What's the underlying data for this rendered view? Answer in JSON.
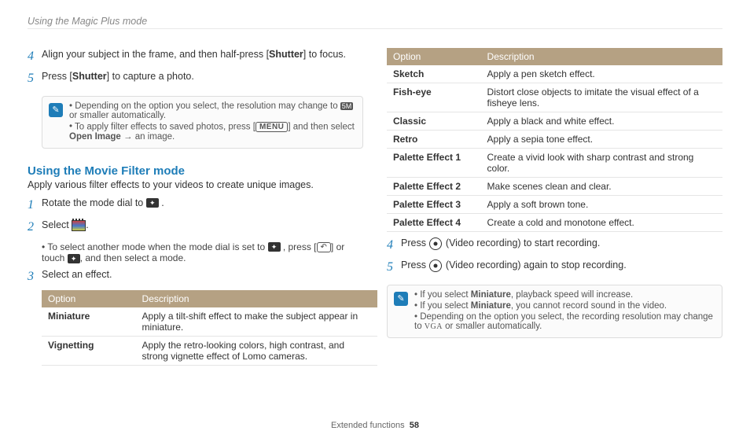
{
  "header": {
    "path": "Using the Magic Plus mode"
  },
  "left": {
    "step4": {
      "num": "4",
      "text_before": "Align your subject in the frame, and then half-press [",
      "shutter": "Shutter",
      "text_after": "] to focus."
    },
    "step5": {
      "num": "5",
      "text_before": "Press [",
      "shutter": "Shutter",
      "text_after": "] to capture a photo."
    },
    "note1": {
      "item1_a": "Depending on the option you select, the resolution may change to ",
      "item1_chip": "5M",
      "item1_b": " or smaller automatically.",
      "item2_a": "To apply filter effects to saved photos, press [",
      "item2_menu": "MENU",
      "item2_b": "] and then select ",
      "item2_open": "Open Image",
      "item2_c": " → an image."
    },
    "section": {
      "title": "Using the Movie Filter mode",
      "sub": "Apply various filter effects to your videos to create unique images."
    },
    "s1": {
      "num": "1",
      "text": "Rotate the mode dial to ",
      "dial": "✦"
    },
    "s2": {
      "num": "2",
      "text": "Select ",
      "sub_a": "To select another mode when the mode dial is set to ",
      "sub_b": " , press [",
      "sub_c": "] or touch ",
      "sub_d": ", and then select a mode."
    },
    "s3": {
      "num": "3",
      "text": "Select an effect."
    },
    "table1": {
      "h1": "Option",
      "h2": "Description",
      "rows": [
        {
          "opt": "Miniature",
          "desc": "Apply a tilt-shift effect to make the subject appear in miniature."
        },
        {
          "opt": "Vignetting",
          "desc": "Apply the retro-looking colors, high contrast, and strong vignette effect of Lomo cameras."
        }
      ]
    }
  },
  "right": {
    "table2": {
      "h1": "Option",
      "h2": "Description",
      "rows": [
        {
          "opt": "Sketch",
          "desc": "Apply a pen sketch effect."
        },
        {
          "opt": "Fish-eye",
          "desc": "Distort close objects to imitate the visual effect of a fisheye lens."
        },
        {
          "opt": "Classic",
          "desc": "Apply a black and white effect."
        },
        {
          "opt": "Retro",
          "desc": "Apply a sepia tone effect."
        },
        {
          "opt": "Palette Effect 1",
          "desc": "Create a vivid look with sharp contrast and strong color."
        },
        {
          "opt": "Palette Effect 2",
          "desc": "Make scenes clean and clear."
        },
        {
          "opt": "Palette Effect 3",
          "desc": "Apply a soft brown tone."
        },
        {
          "opt": "Palette Effect 4",
          "desc": "Create a cold and monotone effect."
        }
      ]
    },
    "step4r": {
      "num": "4",
      "a": "Press ",
      "b": " (Video recording) to start recording."
    },
    "step5r": {
      "num": "5",
      "a": "Press ",
      "b": " (Video recording) again to stop recording."
    },
    "note2": {
      "i1a": "If you select ",
      "i1b": "Miniature",
      "i1c": ", playback speed will increase.",
      "i2a": "If you select ",
      "i2b": "Miniature",
      "i2c": ", you cannot record sound in the video.",
      "i3a": "Depending on the option you select, the recording resolution may change to ",
      "i3vga": "VGA",
      "i3b": " or smaller automatically."
    }
  },
  "footer": {
    "label": "Extended functions",
    "page": "58"
  }
}
